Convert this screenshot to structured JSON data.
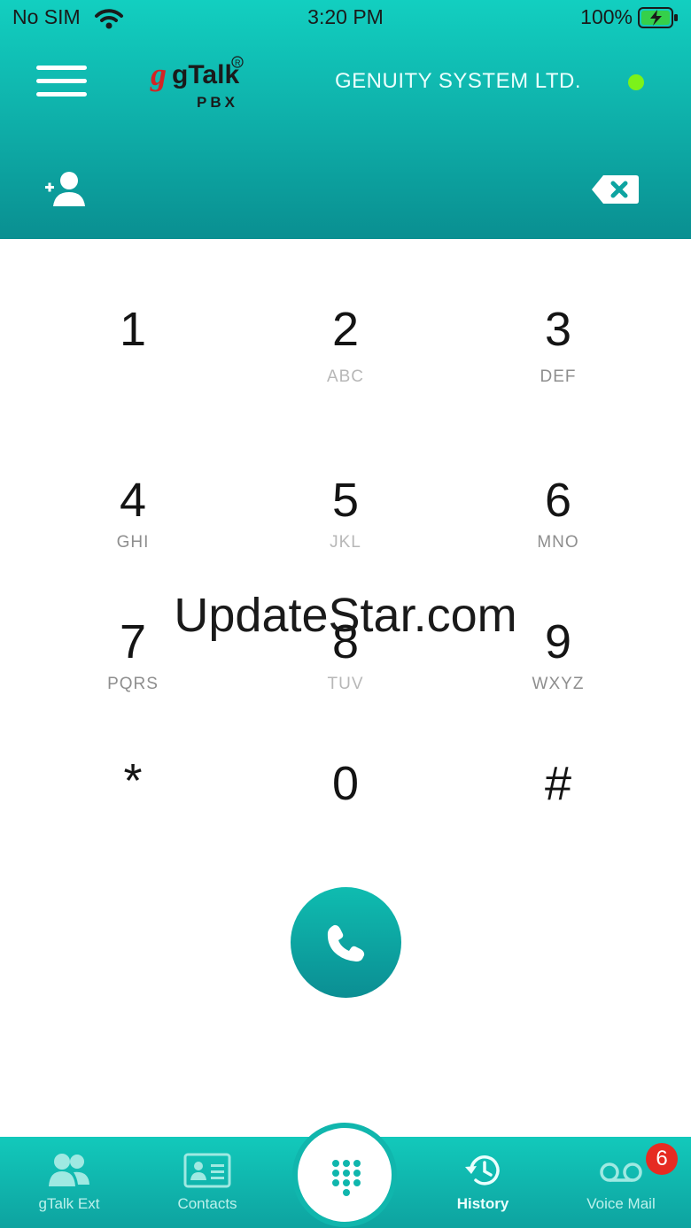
{
  "status_bar": {
    "carrier": "No SIM",
    "time": "3:20 PM",
    "battery": "100%"
  },
  "header": {
    "logo_text": "gTalk",
    "logo_sub": "PBX",
    "company": "GENUITY SYSTEM LTD.",
    "online_color": "#7cf21a",
    "icons": [
      "menu-icon",
      "add-contact-icon",
      "backspace-icon"
    ]
  },
  "keypad": {
    "keys": [
      {
        "digit": "1",
        "letters": ""
      },
      {
        "digit": "2",
        "letters": "ABC"
      },
      {
        "digit": "3",
        "letters": "DEF"
      },
      {
        "digit": "4",
        "letters": "GHI"
      },
      {
        "digit": "5",
        "letters": "JKL"
      },
      {
        "digit": "6",
        "letters": "MNO"
      },
      {
        "digit": "7",
        "letters": "PQRS"
      },
      {
        "digit": "8",
        "letters": "TUV"
      },
      {
        "digit": "9",
        "letters": "WXYZ"
      },
      {
        "digit": "*",
        "letters": ""
      },
      {
        "digit": "0",
        "letters": ""
      },
      {
        "digit": "#",
        "letters": ""
      }
    ]
  },
  "watermark": "UpdateStar.com",
  "tabs": {
    "ext": "gTalk Ext",
    "contacts": "Contacts",
    "history": "History",
    "voicemail": "Voice Mail",
    "voicemail_badge": "6"
  },
  "colors": {
    "accent": "#10b6ad",
    "badge": "#e62b22"
  }
}
